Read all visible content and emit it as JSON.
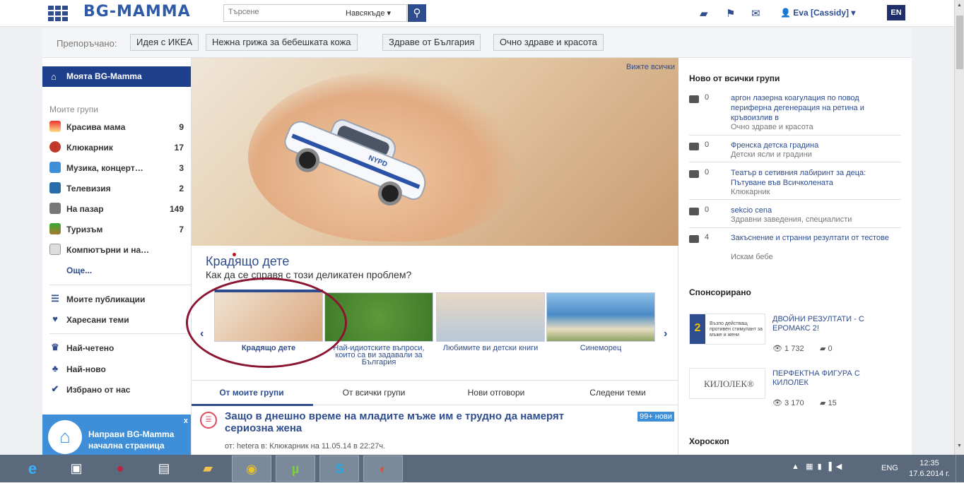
{
  "header": {
    "logo": "BG-MAMMA",
    "search_placeholder": "Търсене",
    "search_scope": "Навсякъде",
    "user": "Eva [Cassidy]",
    "lang": "EN"
  },
  "recommended": {
    "label": "Препоръчано:",
    "items": [
      "Идея с ИКЕА",
      "Нежна грижа за бебешката кожа",
      "Здраве от България",
      "Очно здраве и красота"
    ]
  },
  "sidebar": {
    "my_label": "Моята BG-Mamma",
    "groups_title": "Моите групи",
    "groups": [
      {
        "label": "Красива мама",
        "count": "9"
      },
      {
        "label": "Клюкарник",
        "count": "17"
      },
      {
        "label": "Музика, концерт…",
        "count": "3"
      },
      {
        "label": "Телевизия",
        "count": "2"
      },
      {
        "label": "На пазар",
        "count": "149"
      },
      {
        "label": "Туризъм",
        "count": "7"
      },
      {
        "label": "Компютърни и на…",
        "count": ""
      }
    ],
    "more": "Още...",
    "links1": [
      "Моите публикации",
      "Харесани теми"
    ],
    "links2": [
      "Най-четено",
      "Най-ново",
      "Избрано от нас"
    ],
    "promo": "Направи BG-Mamma начална страница",
    "promo_close": "x"
  },
  "hero": {
    "see_all": "Вижте всички",
    "title": "Крадящо дете",
    "subtitle": "Как да се справя с този деликатен проблем?",
    "car_plate": "NYPD"
  },
  "carousel": {
    "prev": "‹",
    "next": "›",
    "items": [
      {
        "caption": "Крадящо дете"
      },
      {
        "caption": "Най-идиотските въпроси, които са ви задавали за България"
      },
      {
        "caption": "Любимите ви детски книги"
      },
      {
        "caption": "Синеморец"
      }
    ]
  },
  "tabs": [
    "От моите групи",
    "От всички групи",
    "Нови отговори",
    "Следени теми"
  ],
  "post": {
    "title": "Защо в днешно време на младите мъже им е трудно да намерят сериозна жена",
    "badge": "99+ нови",
    "meta": "от: hetera в: Клюкарник на 11.05.14 в 22:27ч."
  },
  "right": {
    "new_title": "Ново от всички групи",
    "news": [
      {
        "count": "0",
        "title": "аргон лазерна коагулация по повод периферна дегенерация на ретина и кръвоизлив в",
        "group": "Очно здраве и красота"
      },
      {
        "count": "0",
        "title": "Френска детска градина",
        "group": "Детски ясли и градини"
      },
      {
        "count": "0",
        "title": "Театър в сетивния лабиринт за деца: Пътуване във Всичколената",
        "group": "Клюкарник"
      },
      {
        "count": "0",
        "title": "sekcio cena",
        "group": "Здравни заведения, специалисти"
      },
      {
        "count": "4",
        "title": "Закъснение и странни резултати от тестове",
        "group": "Искам бебе"
      }
    ],
    "sponsored_title": "Спонсорирано",
    "ads": [
      {
        "title": "ДВОЙНИ РЕЗУЛТАТИ - С ЕРОМАКС 2!",
        "views": "1 732",
        "comments": "0",
        "img_text": "Възпо действащ противен стимулант за мъже и жени"
      },
      {
        "title": "ПЕРФЕКТНА ФИГУРА С КИЛОЛЕК",
        "views": "3 170",
        "comments": "15",
        "img_text": "КИЛОЛЕК®"
      }
    ],
    "horoscope": "Хороскоп"
  },
  "taskbar": {
    "lang": "ENG",
    "time": "12:35",
    "date": "17.6.2014 г."
  },
  "colors": {
    "brand": "#2e4d8f",
    "accent": "#3e8fd8",
    "circle": "#8b1530"
  }
}
